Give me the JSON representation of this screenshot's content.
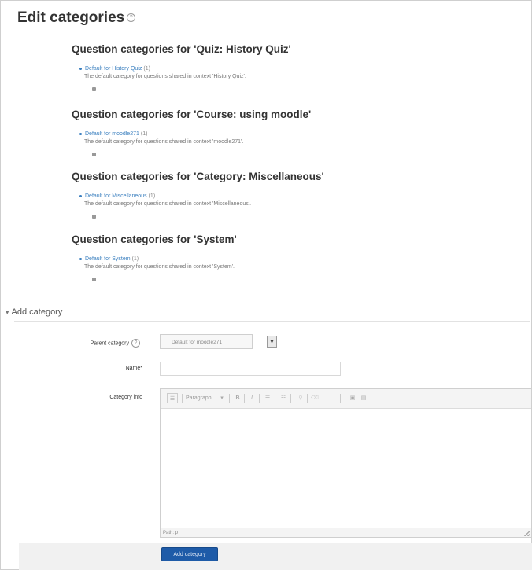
{
  "page": {
    "title": "Edit categories",
    "help_glyph": "?"
  },
  "categories": [
    {
      "heading": "Question categories for 'Quiz: History Quiz'",
      "link": "Default for History Quiz",
      "count": "(1)",
      "description": "The default category for questions shared in context 'History Quiz'."
    },
    {
      "heading": "Question categories for 'Course: using moodle'",
      "link": "Default for moodle271",
      "count": "(1)",
      "description": "The default category for questions shared in context 'moodle271'."
    },
    {
      "heading": "Question categories for 'Category: Miscellaneous'",
      "link": "Default for Miscellaneous",
      "count": "(1)",
      "description": "The default category for questions shared in context 'Miscellaneous'."
    },
    {
      "heading": "Question categories for 'System'",
      "link": "Default for System",
      "count": "(1)",
      "description": "The default category for questions shared in context 'System'."
    }
  ],
  "add_category": {
    "legend": "Add category",
    "twisty": "▾",
    "parent_label": "Parent category",
    "parent_value": "Default for moodle271",
    "name_label": "Name*",
    "info_label": "Category info",
    "toolbar": {
      "format": "Paragraph",
      "bold": "B",
      "italic": "I",
      "list_ul": "☰",
      "list_ol": "☷",
      "link": "⚲",
      "unlink": "⌫",
      "image": "▣",
      "media": "▤",
      "toggle": "☰"
    },
    "path": "Path: p",
    "submit": "Add category"
  }
}
